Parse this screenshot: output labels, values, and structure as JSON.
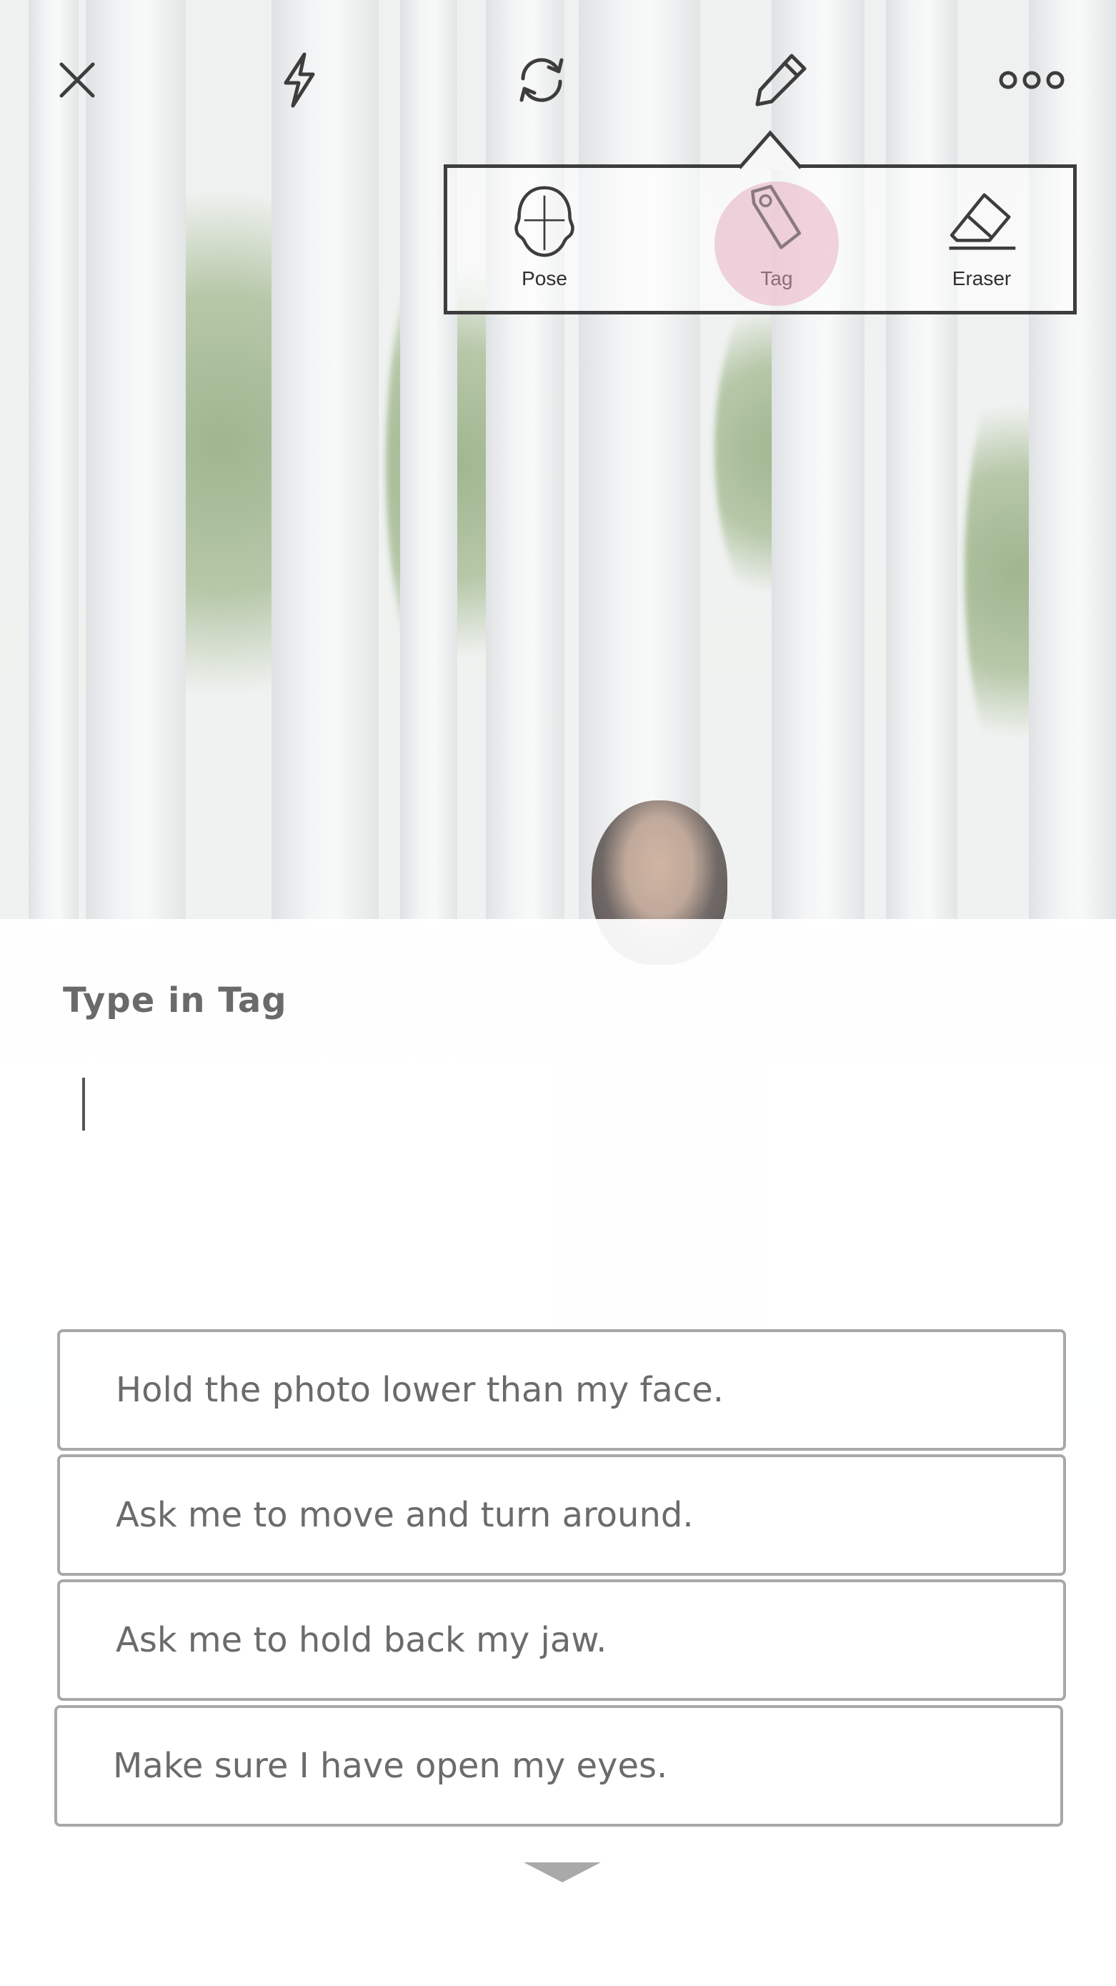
{
  "toolbar": {
    "icons": [
      "close-icon",
      "flash-icon",
      "switch-camera-icon",
      "edit-pencil-icon",
      "more-icon"
    ],
    "icon_color": "#3d3d3d"
  },
  "edit_popup": {
    "tools": [
      {
        "label": "Pose",
        "icon": "pose-head-icon",
        "active": false
      },
      {
        "label": "Tag",
        "icon": "tag-icon",
        "active": true
      },
      {
        "label": "Eraser",
        "icon": "eraser-icon",
        "active": false
      }
    ],
    "active_highlight_color": "#e8afc3"
  },
  "tag_sheet": {
    "title": "Type in Tag",
    "input_value": "",
    "suggestions": [
      "Hold the photo lower than my face.",
      "Ask me to move and turn around.",
      "Ask me to hold back my jaw.",
      "Make sure I have open my eyes."
    ],
    "more_icon": "chevron-down-icon"
  }
}
